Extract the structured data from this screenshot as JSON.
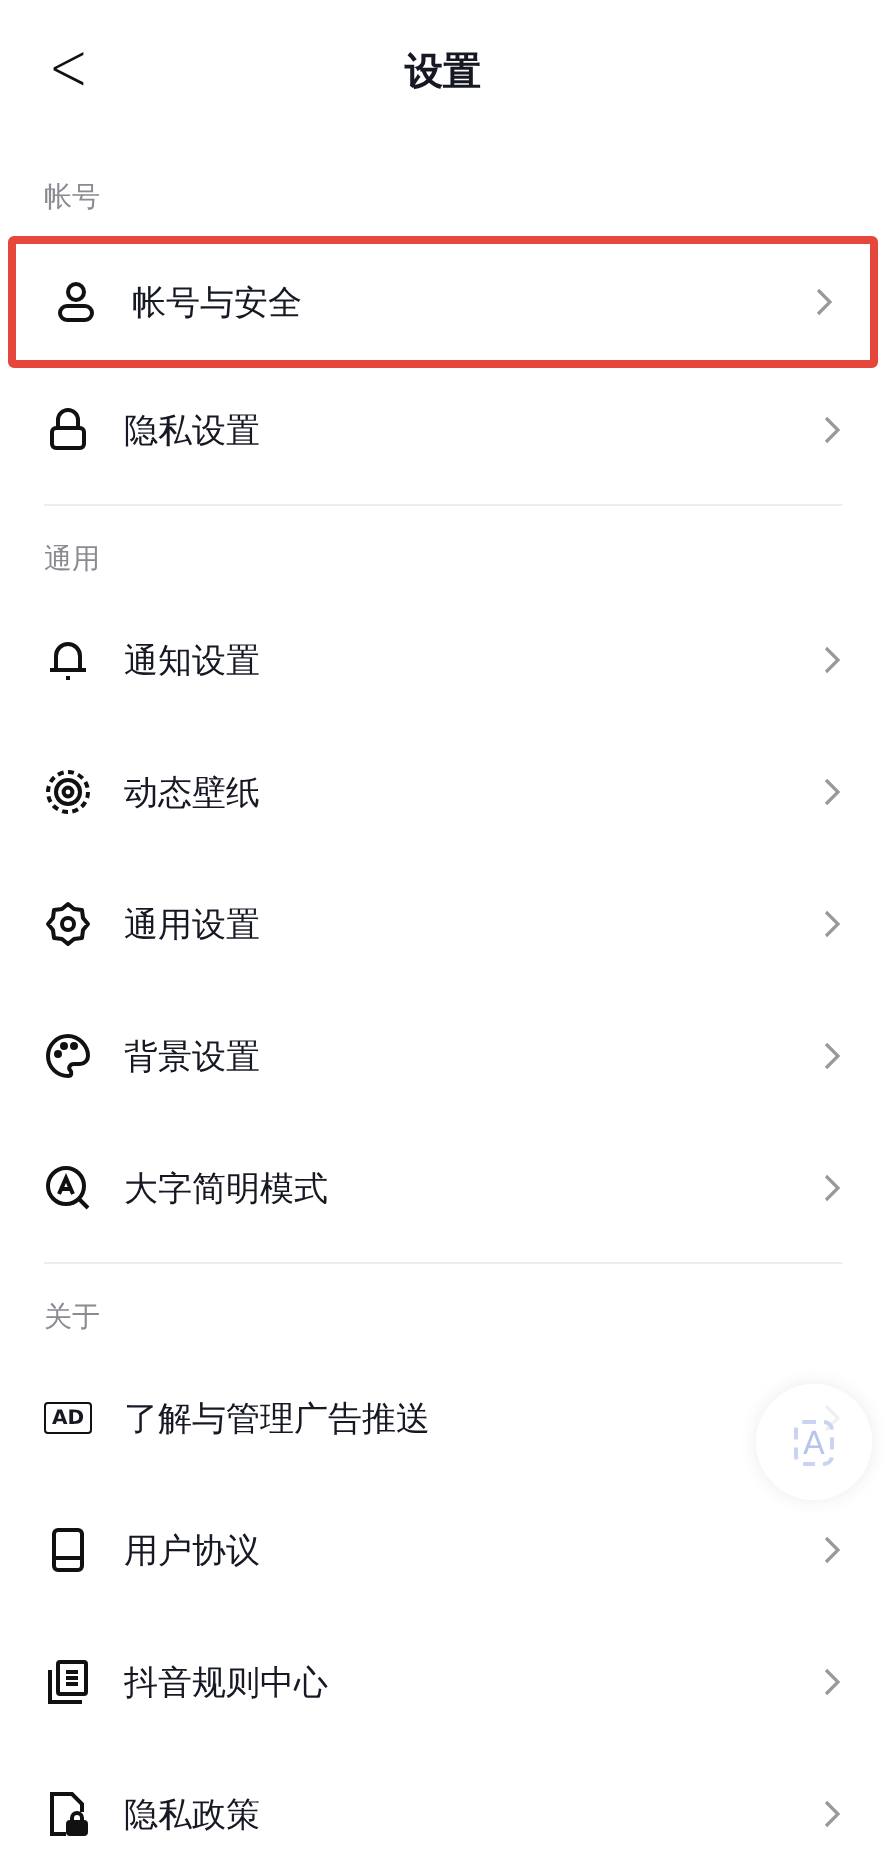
{
  "header": {
    "back": "<",
    "title": "设置"
  },
  "sections": [
    {
      "label": "帐号",
      "items": [
        {
          "label": "帐号与安全",
          "highlighted": true
        },
        {
          "label": "隐私设置",
          "highlighted": false
        }
      ]
    },
    {
      "label": "通用",
      "items": [
        {
          "label": "通知设置",
          "highlighted": false
        },
        {
          "label": "动态壁纸",
          "highlighted": false
        },
        {
          "label": "通用设置",
          "highlighted": false
        },
        {
          "label": "背景设置",
          "highlighted": false
        },
        {
          "label": "大字简明模式",
          "highlighted": false
        }
      ]
    },
    {
      "label": "关于",
      "items": [
        {
          "icon_text": "AD",
          "label": "了解与管理广告推送",
          "highlighted": false
        },
        {
          "label": "用户协议",
          "highlighted": false
        },
        {
          "label": "抖音规则中心",
          "highlighted": false
        },
        {
          "label": "隐私政策",
          "highlighted": false
        }
      ]
    }
  ],
  "floating_button": {
    "label": "A"
  }
}
